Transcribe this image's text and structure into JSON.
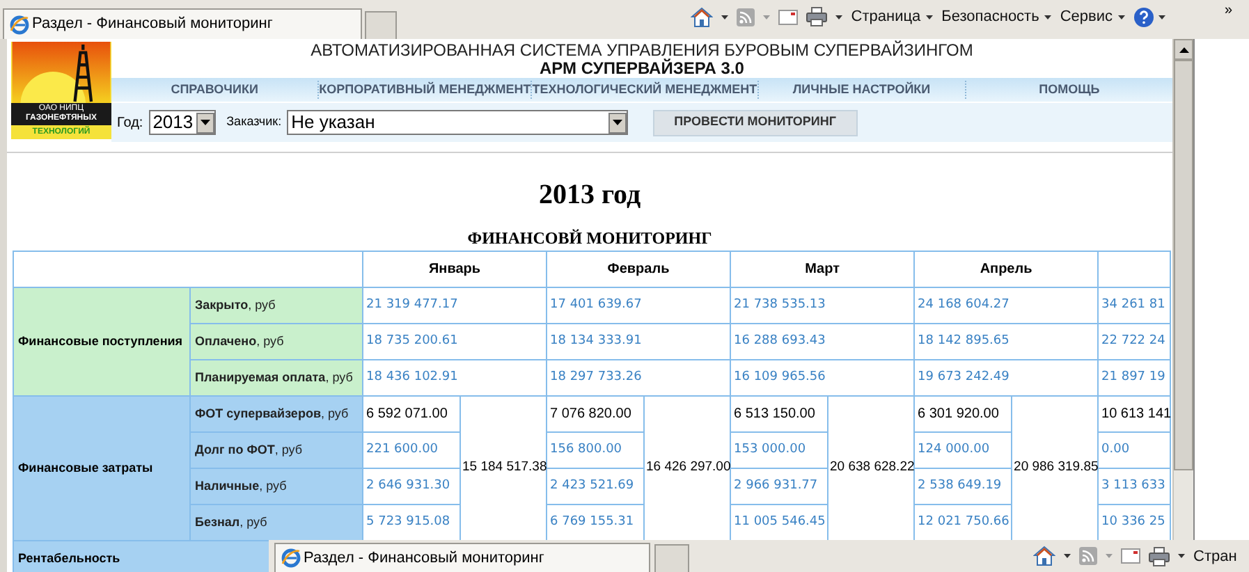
{
  "browser": {
    "tab_title": "Раздел - Финансовый мониторинг",
    "menus": [
      "Страница",
      "Безопасность",
      "Сервис"
    ],
    "overflow": "»"
  },
  "header": {
    "logo": [
      "ОАО НИПЦ",
      "ГАЗОНЕФТЯНЫХ",
      "ТЕХНОЛОГИЙ"
    ],
    "title": "АВТОМАТИЗИРОВАННАЯ СИСТЕМА УПРАВЛЕНИЯ БУРОВЫМ СУПЕРВАЙЗИНГОМ",
    "subtitle": "АРМ СУПЕРВАЙЗЕРА 3.0"
  },
  "nav": [
    "СПРАВОЧИКИ",
    "КОРПОРАТИВНЫЙ МЕНЕДЖМЕНТ",
    "ТЕХНОЛОГИЧЕСКИЙ МЕНЕДЖМЕНТ",
    "ЛИЧНЫЕ НАСТРОЙКИ",
    "ПОМОЩЬ"
  ],
  "filters": {
    "year_label": "Год:",
    "year": "2013",
    "customer_label": "Заказчик:",
    "customer": "Не указан",
    "button": "ПРОВЕСТИ МОНИТОРИНГ"
  },
  "report": {
    "year_title": "2013 год",
    "title": "ФИНАНСОВЙ МОНИТОРИНГ"
  },
  "table": {
    "income_group": "Финансовые поступления",
    "income_rows": [
      {
        "label": "**Закрыто**, руб",
        "kind": "link"
      },
      {
        "label": "**Оплачено**, руб",
        "kind": "link"
      },
      {
        "label": "**Планируемая оплата**, руб",
        "kind": "link"
      }
    ],
    "cost_group": "Финансовые затраты",
    "cost_rows": [
      {
        "label": "**ФОТ супервайзеров**, руб",
        "kind": "plain"
      },
      {
        "label": "**Долг по ФОТ**, руб",
        "kind": "link"
      },
      {
        "label": "**Наличные**, руб",
        "kind": "link"
      },
      {
        "label": "**Безнал**, руб",
        "kind": "link"
      }
    ],
    "profit_group": "Рентабельность",
    "months": [
      {
        "name": "Январь",
        "income": [
          "21 319 477.17",
          "18 735 200.61",
          "18 436 102.91"
        ],
        "costs": [
          "6 592 071.00",
          "221 600.00",
          "2 646 931.30",
          "5 723 915.08"
        ],
        "total": "15 184 517.38"
      },
      {
        "name": "Февраль",
        "income": [
          "17 401 639.67",
          "18 134 333.91",
          "18 297 733.26"
        ],
        "costs": [
          "7 076 820.00",
          "156 800.00",
          "2 423 521.69",
          "6 769 155.31"
        ],
        "total": "16 426 297.00"
      },
      {
        "name": "Март",
        "income": [
          "21 738 535.13",
          "16 288 693.43",
          "16 109 965.56"
        ],
        "costs": [
          "6 513 150.00",
          "153 000.00",
          "2 966 931.77",
          "11 005 546.45"
        ],
        "total": "20 638 628.22"
      },
      {
        "name": "Апрель",
        "income": [
          "24 168 604.27",
          "18 142 895.65",
          "19 673 242.49"
        ],
        "costs": [
          "6 301 920.00",
          "124 000.00",
          "2 538 649.19",
          "12 021 750.66"
        ],
        "total": "20 986 319.85"
      },
      {
        "income": [
          "34 261 81",
          "22 722 24",
          "21 897 19"
        ],
        "costs": [
          "10 613 141",
          "0.00",
          "3 113 633",
          "10 336 25"
        ]
      }
    ]
  },
  "overlay_bar": {
    "tab_title": "Раздел - Финансовый мониторинг",
    "menu": "Стран"
  }
}
